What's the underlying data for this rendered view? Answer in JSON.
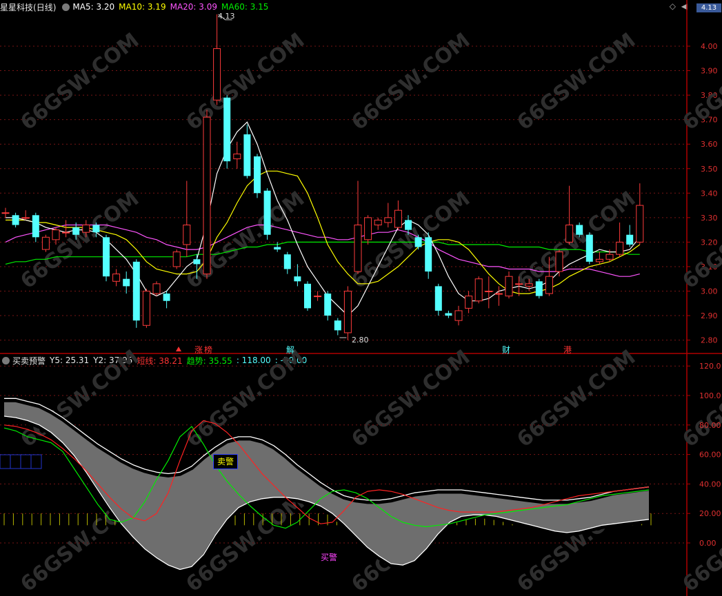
{
  "header_main": {
    "stock": "星星科技",
    "period": "(日线)",
    "ma5": "MA5: 3.20",
    "ma10": "MA10: 3.19",
    "ma20": "MA20: 3.09",
    "ma60": "MA60: 3.15"
  },
  "header_ind": {
    "name": "买卖预警",
    "y5": "Y5: 25.31",
    "y2": "Y2: 37.95",
    "short": "短线: 38.21",
    "trend": "趋势: 35.55",
    "v1": ": 118.00",
    "v2": ": -30.00"
  },
  "markers": {
    "zhang": "涨",
    "bang": "榜",
    "jie": "解",
    "cai": "财",
    "gang": "港",
    "sell": "卖警",
    "buy": "买警",
    "high_label": "4.13",
    "low_label": "2.80",
    "corner_value": "4.13"
  },
  "watermark": "66GSW.COM",
  "colors": {
    "up": "#ff3b3b",
    "down": "#54ffff",
    "ma5": "#ffffff",
    "ma10": "#ffff00",
    "ma20": "#ff55ff",
    "ma60": "#00ee00"
  },
  "chart_data": [
    {
      "type": "candlestick",
      "title": "星星科技 (日线)",
      "ylim": [
        2.75,
        4.2
      ],
      "y_ticks": [
        "4.00",
        "3.90",
        "3.80",
        "3.70",
        "3.60",
        "3.50",
        "3.40",
        "3.30",
        "3.20",
        "3.10",
        "3.00",
        "2.90",
        "2.80"
      ],
      "candles": [
        {
          "o": 3.32,
          "c": 3.32,
          "h": 3.34,
          "l": 3.3
        },
        {
          "o": 3.31,
          "c": 3.27,
          "h": 3.32,
          "l": 3.26
        },
        {
          "o": 3.3,
          "c": 3.3,
          "h": 3.33,
          "l": 3.29
        },
        {
          "o": 3.31,
          "c": 3.22,
          "h": 3.32,
          "l": 3.2
        },
        {
          "o": 3.17,
          "c": 3.22,
          "h": 3.23,
          "l": 3.16
        },
        {
          "o": 3.21,
          "c": 3.25,
          "h": 3.26,
          "l": 3.19
        },
        {
          "o": 3.24,
          "c": 3.24,
          "h": 3.29,
          "l": 3.22
        },
        {
          "o": 3.26,
          "c": 3.23,
          "h": 3.28,
          "l": 3.21
        },
        {
          "o": 3.24,
          "c": 3.27,
          "h": 3.29,
          "l": 3.22
        },
        {
          "o": 3.27,
          "c": 3.24,
          "h": 3.28,
          "l": 3.22
        },
        {
          "o": 3.22,
          "c": 3.06,
          "h": 3.23,
          "l": 3.04
        },
        {
          "o": 3.04,
          "c": 3.07,
          "h": 3.09,
          "l": 3.02
        },
        {
          "o": 3.05,
          "c": 3.02,
          "h": 3.08,
          "l": 2.99
        },
        {
          "o": 3.12,
          "c": 2.88,
          "h": 3.13,
          "l": 2.85
        },
        {
          "o": 2.86,
          "c": 3.0,
          "h": 3.01,
          "l": 2.85
        },
        {
          "o": 2.99,
          "c": 3.03,
          "h": 3.04,
          "l": 2.98
        },
        {
          "o": 2.99,
          "c": 2.96,
          "h": 3.0,
          "l": 2.93
        },
        {
          "o": 3.1,
          "c": 3.16,
          "h": 3.17,
          "l": 3.09
        },
        {
          "o": 3.19,
          "c": 3.27,
          "h": 3.45,
          "l": 3.14
        },
        {
          "o": 3.13,
          "c": 3.11,
          "h": 3.15,
          "l": 3.05
        },
        {
          "o": 3.07,
          "c": 3.71,
          "h": 3.74,
          "l": 3.05
        },
        {
          "o": 3.78,
          "c": 3.99,
          "h": 4.13,
          "l": 3.76
        },
        {
          "o": 3.79,
          "c": 3.53,
          "h": 3.8,
          "l": 3.5
        },
        {
          "o": 3.54,
          "c": 3.56,
          "h": 3.61,
          "l": 3.5
        },
        {
          "o": 3.64,
          "c": 3.47,
          "h": 3.68,
          "l": 3.46
        },
        {
          "o": 3.55,
          "c": 3.4,
          "h": 3.56,
          "l": 3.38
        },
        {
          "o": 3.41,
          "c": 3.23,
          "h": 3.42,
          "l": 3.21
        },
        {
          "o": 3.18,
          "c": 3.17,
          "h": 3.2,
          "l": 3.16
        },
        {
          "o": 3.15,
          "c": 3.09,
          "h": 3.16,
          "l": 3.07
        },
        {
          "o": 3.06,
          "c": 3.04,
          "h": 3.11,
          "l": 3.02
        },
        {
          "o": 3.03,
          "c": 2.93,
          "h": 3.04,
          "l": 2.92
        },
        {
          "o": 2.98,
          "c": 2.98,
          "h": 3.0,
          "l": 2.96
        },
        {
          "o": 2.99,
          "c": 2.9,
          "h": 3.0,
          "l": 2.88
        },
        {
          "o": 2.88,
          "c": 2.84,
          "h": 2.89,
          "l": 2.82
        },
        {
          "o": 2.83,
          "c": 3.0,
          "h": 3.02,
          "l": 2.8
        },
        {
          "o": 3.08,
          "c": 3.27,
          "h": 3.45,
          "l": 3.07
        },
        {
          "o": 3.21,
          "c": 3.3,
          "h": 3.31,
          "l": 3.19
        },
        {
          "o": 3.27,
          "c": 3.29,
          "h": 3.3,
          "l": 3.25
        },
        {
          "o": 3.28,
          "c": 3.3,
          "h": 3.36,
          "l": 3.26
        },
        {
          "o": 3.26,
          "c": 3.33,
          "h": 3.37,
          "l": 3.25
        },
        {
          "o": 3.29,
          "c": 3.25,
          "h": 3.31,
          "l": 3.23
        },
        {
          "o": 3.22,
          "c": 3.18,
          "h": 3.23,
          "l": 3.17
        },
        {
          "o": 3.22,
          "c": 3.08,
          "h": 3.24,
          "l": 3.05
        },
        {
          "o": 3.02,
          "c": 2.92,
          "h": 3.03,
          "l": 2.9
        },
        {
          "o": 2.91,
          "c": 2.9,
          "h": 2.92,
          "l": 2.89
        },
        {
          "o": 2.88,
          "c": 2.92,
          "h": 2.94,
          "l": 2.86
        },
        {
          "o": 2.93,
          "c": 2.98,
          "h": 3.0,
          "l": 2.91
        },
        {
          "o": 2.96,
          "c": 3.05,
          "h": 3.06,
          "l": 2.95
        },
        {
          "o": 3.0,
          "c": 3.0,
          "h": 3.06,
          "l": 2.93
        },
        {
          "o": 2.99,
          "c": 2.99,
          "h": 3.02,
          "l": 2.94
        },
        {
          "o": 2.98,
          "c": 3.06,
          "h": 3.08,
          "l": 2.97
        },
        {
          "o": 3.03,
          "c": 3.03,
          "h": 3.06,
          "l": 2.98
        },
        {
          "o": 3.02,
          "c": 3.03,
          "h": 3.05,
          "l": 3.0
        },
        {
          "o": 3.04,
          "c": 2.98,
          "h": 3.05,
          "l": 2.97
        },
        {
          "o": 2.99,
          "c": 3.06,
          "h": 3.14,
          "l": 2.98
        },
        {
          "o": 3.08,
          "c": 3.16,
          "h": 3.17,
          "l": 3.06
        },
        {
          "o": 3.2,
          "c": 3.27,
          "h": 3.43,
          "l": 3.19
        },
        {
          "o": 3.27,
          "c": 3.23,
          "h": 3.28,
          "l": 3.22
        },
        {
          "o": 3.23,
          "c": 3.12,
          "h": 3.24,
          "l": 3.11
        },
        {
          "o": 3.12,
          "c": 3.13,
          "h": 3.16,
          "l": 3.11
        },
        {
          "o": 3.13,
          "c": 3.15,
          "h": 3.17,
          "l": 3.12
        },
        {
          "o": 3.15,
          "c": 3.2,
          "h": 3.28,
          "l": 3.14
        },
        {
          "o": 3.23,
          "c": 3.19,
          "h": 3.27,
          "l": 3.18
        },
        {
          "o": 3.2,
          "c": 3.35,
          "h": 3.44,
          "l": 3.19
        }
      ],
      "ma5": [
        3.3,
        3.3,
        3.29,
        3.28,
        3.26,
        3.25,
        3.24,
        3.25,
        3.25,
        3.24,
        3.21,
        3.17,
        3.13,
        3.07,
        3.0,
        2.98,
        3.0,
        3.05,
        3.1,
        3.13,
        3.28,
        3.48,
        3.58,
        3.65,
        3.69,
        3.6,
        3.48,
        3.37,
        3.29,
        3.19,
        3.1,
        3.04,
        2.98,
        2.94,
        2.9,
        2.94,
        3.02,
        3.1,
        3.18,
        3.26,
        3.29,
        3.27,
        3.23,
        3.15,
        3.06,
        2.99,
        2.96,
        2.96,
        2.97,
        3.0,
        3.01,
        3.02,
        3.01,
        3.02,
        3.04,
        3.08,
        3.11,
        3.13,
        3.15,
        3.17,
        3.16,
        3.16,
        3.17,
        3.22
      ],
      "ma10": [
        3.29,
        3.29,
        3.29,
        3.28,
        3.28,
        3.27,
        3.26,
        3.26,
        3.26,
        3.25,
        3.24,
        3.23,
        3.21,
        3.17,
        3.12,
        3.09,
        3.08,
        3.07,
        3.07,
        3.08,
        3.13,
        3.22,
        3.28,
        3.36,
        3.43,
        3.47,
        3.49,
        3.49,
        3.48,
        3.47,
        3.4,
        3.3,
        3.19,
        3.12,
        3.07,
        3.03,
        3.03,
        3.04,
        3.07,
        3.1,
        3.14,
        3.18,
        3.2,
        3.21,
        3.21,
        3.2,
        3.17,
        3.12,
        3.07,
        3.03,
        3.0,
        2.99,
        2.99,
        3.0,
        3.01,
        3.03,
        3.06,
        3.08,
        3.1,
        3.11,
        3.12,
        3.14,
        3.16,
        3.19
      ],
      "ma20": [
        3.2,
        3.22,
        3.23,
        3.24,
        3.25,
        3.26,
        3.27,
        3.27,
        3.27,
        3.27,
        3.27,
        3.26,
        3.25,
        3.24,
        3.22,
        3.21,
        3.19,
        3.18,
        3.17,
        3.17,
        3.18,
        3.2,
        3.22,
        3.24,
        3.26,
        3.27,
        3.27,
        3.26,
        3.25,
        3.24,
        3.23,
        3.22,
        3.22,
        3.21,
        3.21,
        3.22,
        3.23,
        3.24,
        3.24,
        3.25,
        3.24,
        3.22,
        3.2,
        3.17,
        3.15,
        3.13,
        3.12,
        3.11,
        3.1,
        3.1,
        3.09,
        3.09,
        3.09,
        3.08,
        3.08,
        3.08,
        3.09,
        3.09,
        3.09,
        3.08,
        3.07,
        3.06,
        3.06,
        3.07
      ],
      "ma60": [
        3.11,
        3.12,
        3.12,
        3.13,
        3.13,
        3.14,
        3.14,
        3.14,
        3.14,
        3.14,
        3.14,
        3.14,
        3.14,
        3.14,
        3.14,
        3.14,
        3.14,
        3.14,
        3.14,
        3.15,
        3.15,
        3.15,
        3.16,
        3.17,
        3.18,
        3.18,
        3.19,
        3.19,
        3.2,
        3.2,
        3.2,
        3.2,
        3.2,
        3.2,
        3.2,
        3.2,
        3.2,
        3.2,
        3.2,
        3.2,
        3.2,
        3.2,
        3.2,
        3.2,
        3.19,
        3.19,
        3.19,
        3.19,
        3.19,
        3.19,
        3.18,
        3.18,
        3.18,
        3.18,
        3.17,
        3.17,
        3.17,
        3.17,
        3.16,
        3.16,
        3.16,
        3.16,
        3.15,
        3.15
      ]
    },
    {
      "type": "line",
      "title": "买卖预警",
      "ylim": [
        -38,
        125
      ],
      "y_ticks": [
        "120.0",
        "100.0",
        "80.00",
        "60.00",
        "40.00",
        "20.00",
        "0.00"
      ],
      "band_upper": [
        98,
        98,
        96,
        94,
        90,
        85,
        79,
        73,
        67,
        62,
        57,
        53,
        50,
        48,
        47,
        48,
        52,
        59,
        65,
        70,
        72,
        72,
        70,
        66,
        60,
        53,
        47,
        41,
        36,
        32,
        30,
        29,
        29,
        30,
        32,
        34,
        35,
        36,
        36,
        36,
        35,
        34,
        33,
        32,
        31,
        30,
        29,
        29,
        29,
        30,
        31,
        33,
        35,
        36,
        37,
        38
      ],
      "band_lower": [
        86,
        85,
        83,
        80,
        75,
        68,
        59,
        48,
        36,
        24,
        13,
        4,
        -4,
        -10,
        -15,
        -18,
        -16,
        -8,
        5,
        16,
        24,
        28,
        30,
        31,
        31,
        30,
        28,
        25,
        20,
        13,
        5,
        -3,
        -9,
        -14,
        -15,
        -12,
        -4,
        6,
        14,
        18,
        19,
        19,
        18,
        16,
        14,
        12,
        10,
        8,
        7,
        8,
        10,
        12,
        13,
        14,
        15,
        16
      ],
      "short_line": [
        80,
        79,
        77,
        74,
        70,
        64,
        57,
        49,
        40,
        31,
        23,
        17,
        15,
        20,
        34,
        56,
        76,
        83,
        81,
        75,
        67,
        57,
        47,
        39,
        31,
        24,
        17,
        13,
        14,
        22,
        31,
        35,
        36,
        35,
        33,
        30,
        27,
        24,
        22,
        21,
        21,
        21,
        21,
        22,
        23,
        24,
        26,
        28,
        30,
        32,
        33,
        34,
        35,
        36,
        37,
        38
      ],
      "trend": [
        78,
        76,
        72,
        70,
        68,
        62,
        50,
        38,
        26,
        16,
        14,
        17,
        28,
        43,
        56,
        72,
        79,
        67,
        53,
        42,
        33,
        25,
        18,
        12,
        10,
        14,
        22,
        30,
        35,
        36,
        34,
        30,
        24,
        18,
        14,
        12,
        11,
        12,
        13,
        15,
        17,
        19,
        20,
        21,
        22,
        23,
        24,
        25,
        26,
        28,
        30,
        32,
        33,
        34,
        35,
        36
      ]
    }
  ]
}
